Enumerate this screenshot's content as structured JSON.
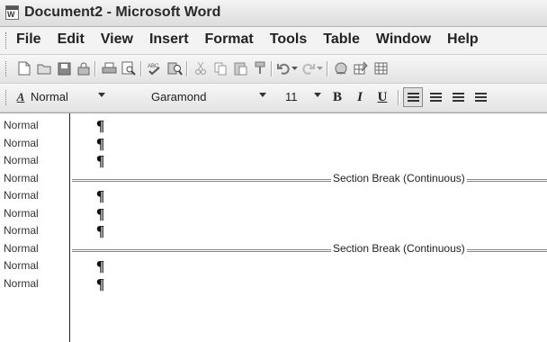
{
  "window": {
    "title": "Document2 - Microsoft Word",
    "icon": "W"
  },
  "menu": {
    "items": [
      {
        "label": "File"
      },
      {
        "label": "Edit"
      },
      {
        "label": "View"
      },
      {
        "label": "Insert"
      },
      {
        "label": "Format"
      },
      {
        "label": "Tools"
      },
      {
        "label": "Table"
      },
      {
        "label": "Window"
      },
      {
        "label": "Help"
      }
    ]
  },
  "formatting": {
    "style": "Normal",
    "font": "Garamond",
    "size": "11",
    "bold": "B",
    "italic": "I",
    "underline": "U",
    "style_icon_text": "A"
  },
  "standard_toolbar_icons": [
    "new-icon",
    "open-icon",
    "save-icon",
    "permission-icon",
    "print-icon",
    "print-preview-icon",
    "spelling-icon",
    "research-icon",
    "cut-icon",
    "copy-icon",
    "paste-icon",
    "format-painter-icon",
    "undo-icon",
    "redo-icon",
    "hyperlink-icon",
    "tables-borders-icon",
    "insert-table-icon"
  ],
  "document": {
    "paragraph_mark": "¶",
    "rows": [
      {
        "style": "Normal",
        "type": "para"
      },
      {
        "style": "Normal",
        "type": "para"
      },
      {
        "style": "Normal",
        "type": "para"
      },
      {
        "style": "Normal",
        "type": "section",
        "label": "Section Break (Continuous)"
      },
      {
        "style": "Normal",
        "type": "para"
      },
      {
        "style": "Normal",
        "type": "para"
      },
      {
        "style": "Normal",
        "type": "para"
      },
      {
        "style": "Normal",
        "type": "section",
        "label": "Section Break (Continuous)"
      },
      {
        "style": "Normal",
        "type": "para"
      },
      {
        "style": "Normal",
        "type": "para"
      }
    ]
  }
}
